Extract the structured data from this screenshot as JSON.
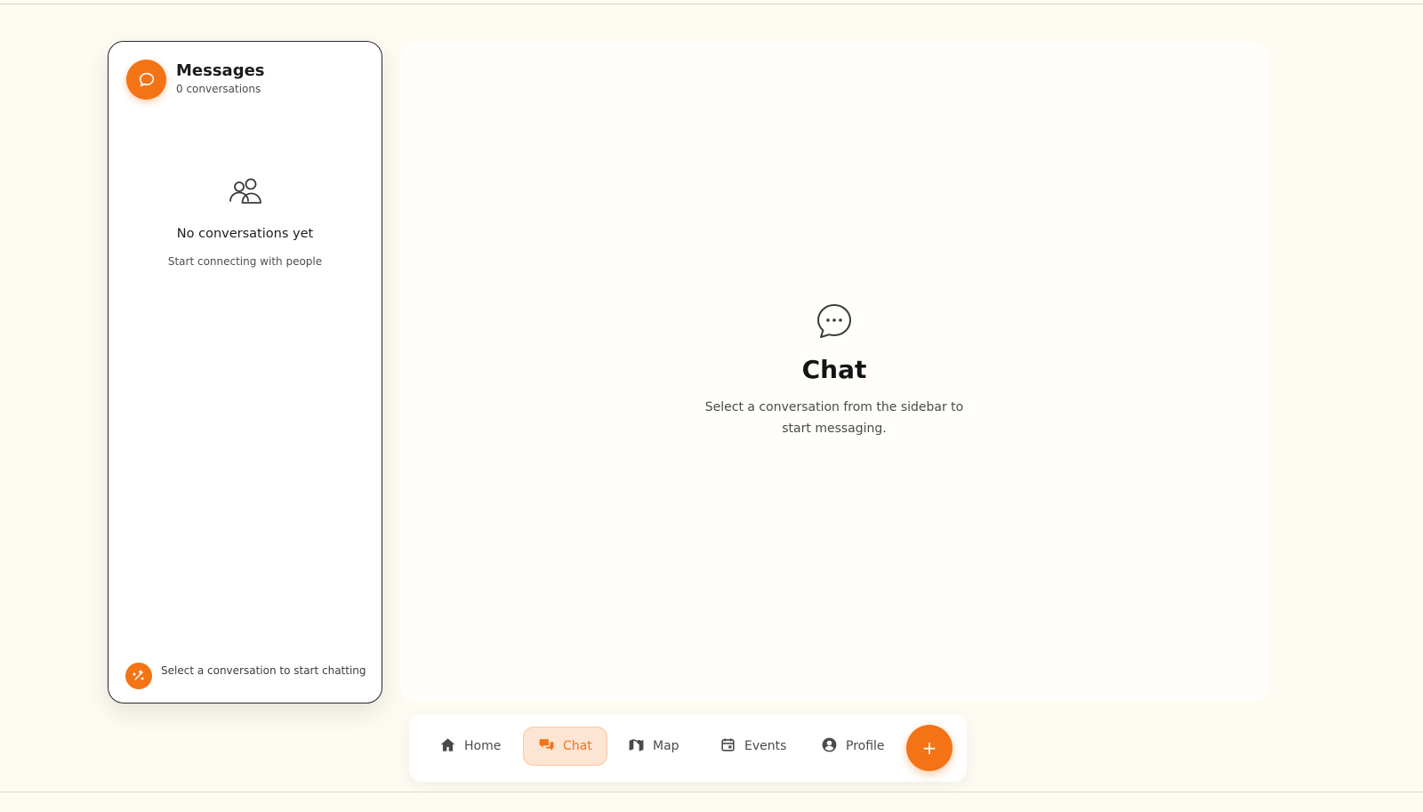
{
  "colors": {
    "accent": "#f47315",
    "accent_soft": "#fde5d3",
    "background": "#fdfbf2"
  },
  "sidebar": {
    "title": "Messages",
    "subtitle": "0 conversations",
    "header_icon": "chat-bubble-icon",
    "empty_icon": "people-icon",
    "empty_title": "No conversations yet",
    "empty_subtitle": "Start connecting with people",
    "footer_icon": "sparkle-icon",
    "footer_text": "Select a conversation to start chatting"
  },
  "main": {
    "icon": "chat-dots-icon",
    "title": "Chat",
    "subtitle": "Select a conversation from the sidebar to start messaging."
  },
  "nav": {
    "items": [
      {
        "label": "Home",
        "icon": "home-icon",
        "active": false
      },
      {
        "label": "Chat",
        "icon": "chat-icon",
        "active": true
      },
      {
        "label": "Map",
        "icon": "map-icon",
        "active": false
      },
      {
        "label": "Events",
        "icon": "calendar-icon",
        "active": false
      },
      {
        "label": "Profile",
        "icon": "user-circle-icon",
        "active": false
      }
    ],
    "fab_label": "+",
    "fab_icon": "plus-icon"
  }
}
